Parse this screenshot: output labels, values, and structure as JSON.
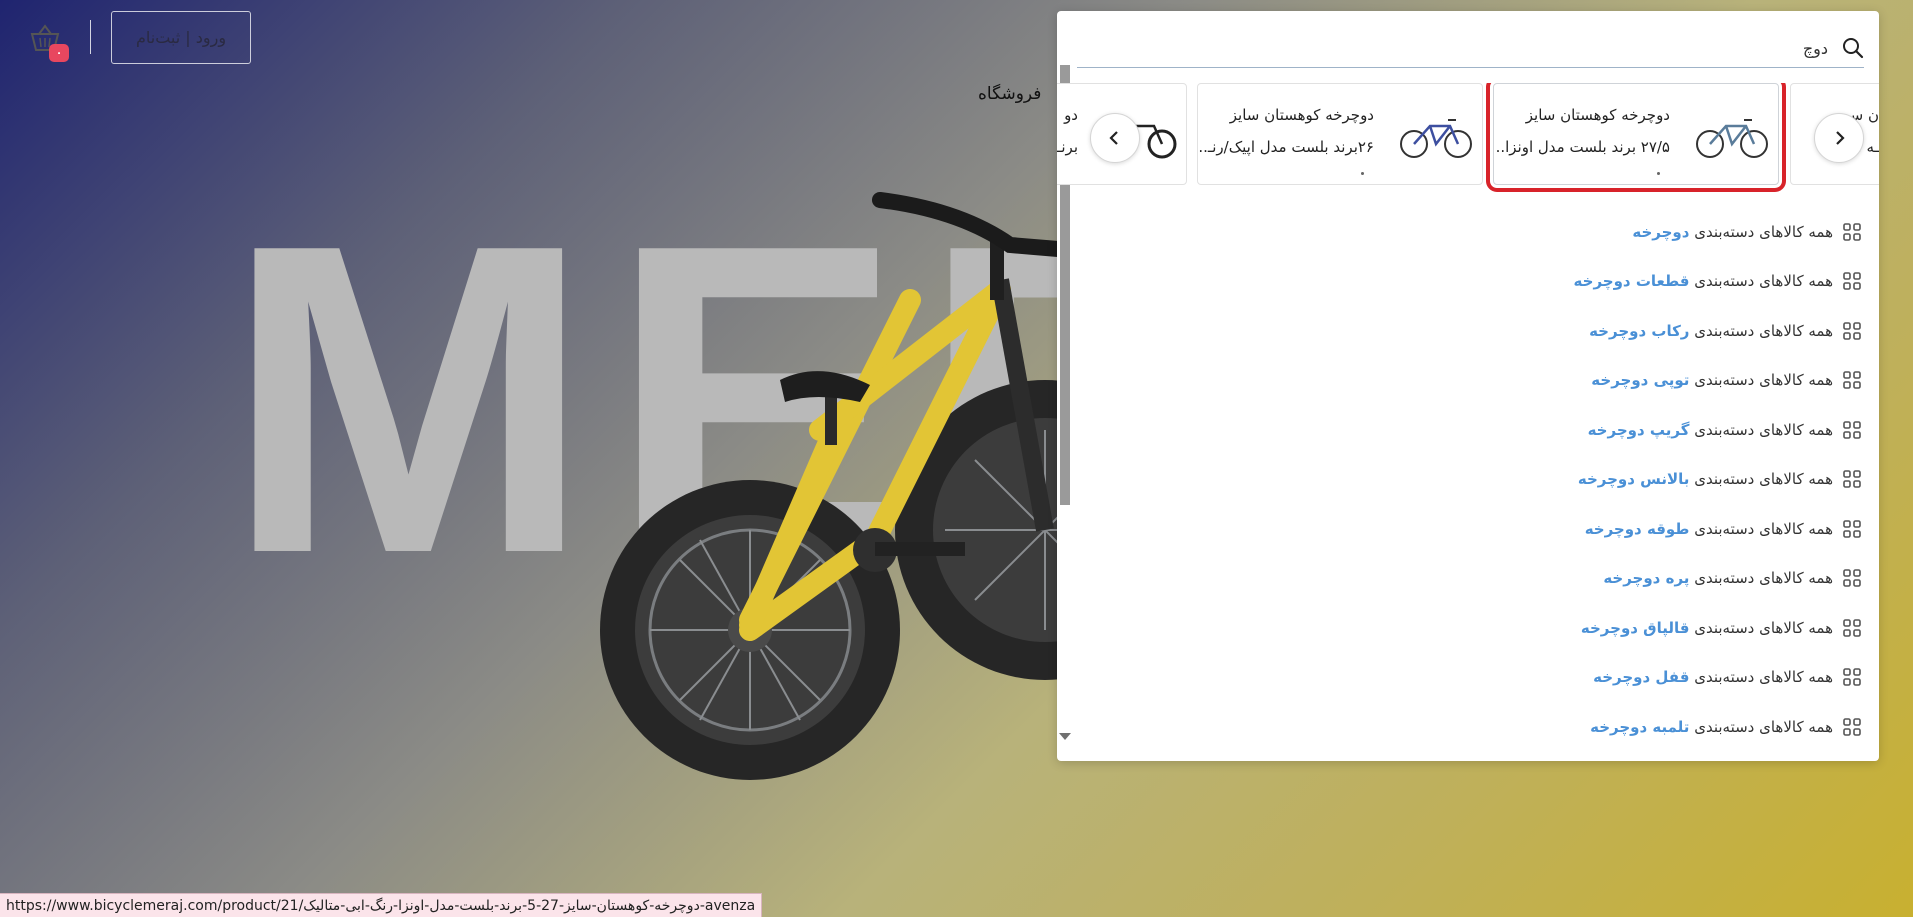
{
  "hero": {
    "word": "MER"
  },
  "header": {
    "login_label": "ورود | ثبت‌نام",
    "cart_count": "۰",
    "nav_shop": "فروشگاه"
  },
  "search": {
    "value": "دوچ",
    "placeholder": ""
  },
  "carousel": {
    "cards": [
      {
        "title": "دوچرخه کوهستان سایز",
        "subtitle": "۲۷/۵ برند بلست مدل اونزا..."
      },
      {
        "title": "دوچرخه کوهستان سایز",
        "subtitle": "۲۶برند بلست مدل اپیک/رنـ..."
      },
      {
        "title": "دو",
        "subtitle": "برنـ"
      },
      {
        "title": "ن سـ",
        "subtitle": "ـه مـ..."
      }
    ]
  },
  "categories": {
    "prefix": "همه کالاهای دسته‌بندی",
    "items": [
      "دوچرخه",
      "قطعات دوچرخه",
      "رکاب دوچرخه",
      "توپی دوچرخه",
      "گریپ دوچرخه",
      "بالانس دوچرخه",
      "طوقه دوچرخه",
      "پره دوچرخه",
      "قالپاق دوچرخه",
      "قفل دوچرخه",
      "تلمبه دوچرخه"
    ]
  },
  "status_bar": {
    "url": "https://www.bicyclemeraj.com/product/21/دوچرخه-کوهستان-سایز-27-5-برند-بلست-مدل-اونزا-رنگ-ابی-متالیک-avenza"
  },
  "colors": {
    "accent_blue": "#4a90d6",
    "badge_red": "#e8475f",
    "highlight_red": "#d8232a"
  }
}
